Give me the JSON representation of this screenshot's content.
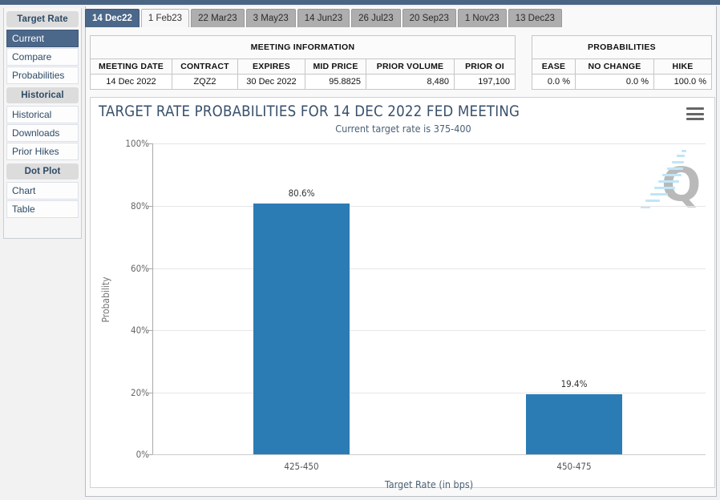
{
  "window": {
    "accent_top": "#4a6484"
  },
  "sidebar": {
    "groups": [
      {
        "header": "Target Rate",
        "items": [
          {
            "label": "Current",
            "active": true
          },
          {
            "label": "Compare",
            "active": false
          },
          {
            "label": "Probabilities",
            "active": false
          }
        ]
      },
      {
        "header": "Historical",
        "items": [
          {
            "label": "Historical",
            "active": false
          },
          {
            "label": "Downloads",
            "active": false
          },
          {
            "label": "Prior Hikes",
            "active": false
          }
        ]
      },
      {
        "header": "Dot Plot",
        "items": [
          {
            "label": "Chart",
            "active": false
          },
          {
            "label": "Table",
            "active": false
          }
        ]
      }
    ]
  },
  "tabs": [
    {
      "label": "14 Dec22",
      "state": "active"
    },
    {
      "label": "1 Feb23",
      "state": "light"
    },
    {
      "label": "22 Mar23",
      "state": "normal"
    },
    {
      "label": "3 May23",
      "state": "normal"
    },
    {
      "label": "14 Jun23",
      "state": "normal"
    },
    {
      "label": "26 Jul23",
      "state": "normal"
    },
    {
      "label": "20 Sep23",
      "state": "normal"
    },
    {
      "label": "1 Nov23",
      "state": "normal"
    },
    {
      "label": "13 Dec23",
      "state": "normal"
    }
  ],
  "meeting_information": {
    "title": "MEETING INFORMATION",
    "columns": [
      "MEETING DATE",
      "CONTRACT",
      "EXPIRES",
      "MID PRICE",
      "PRIOR VOLUME",
      "PRIOR OI"
    ],
    "row": [
      "14 Dec 2022",
      "ZQZ2",
      "30 Dec 2022",
      "95.8825",
      "8,480",
      "197,100"
    ]
  },
  "probabilities": {
    "title": "PROBABILITIES",
    "columns": [
      "EASE",
      "NO CHANGE",
      "HIKE"
    ],
    "row": [
      "0.0 %",
      "0.0 %",
      "100.0 %"
    ]
  },
  "chart_data": {
    "type": "bar",
    "title": "TARGET RATE PROBABILITIES FOR 14 DEC 2022 FED MEETING",
    "subtitle": "Current target rate is 375-400",
    "xlabel": "Target Rate (in bps)",
    "ylabel": "Probability",
    "categories": [
      "425-450",
      "450-475"
    ],
    "values": [
      80.6,
      19.4
    ],
    "data_labels": [
      "80.6%",
      "19.4%"
    ],
    "ylim": [
      0,
      100
    ],
    "yticks": [
      0,
      20,
      40,
      60,
      80,
      100
    ],
    "ytick_labels": [
      "0%",
      "20%",
      "40%",
      "60%",
      "80%",
      "100%"
    ],
    "grid": true,
    "legend": "none",
    "bar_color": "#2b7cb5"
  },
  "menu": {
    "icon_label": "chart-context-menu"
  }
}
